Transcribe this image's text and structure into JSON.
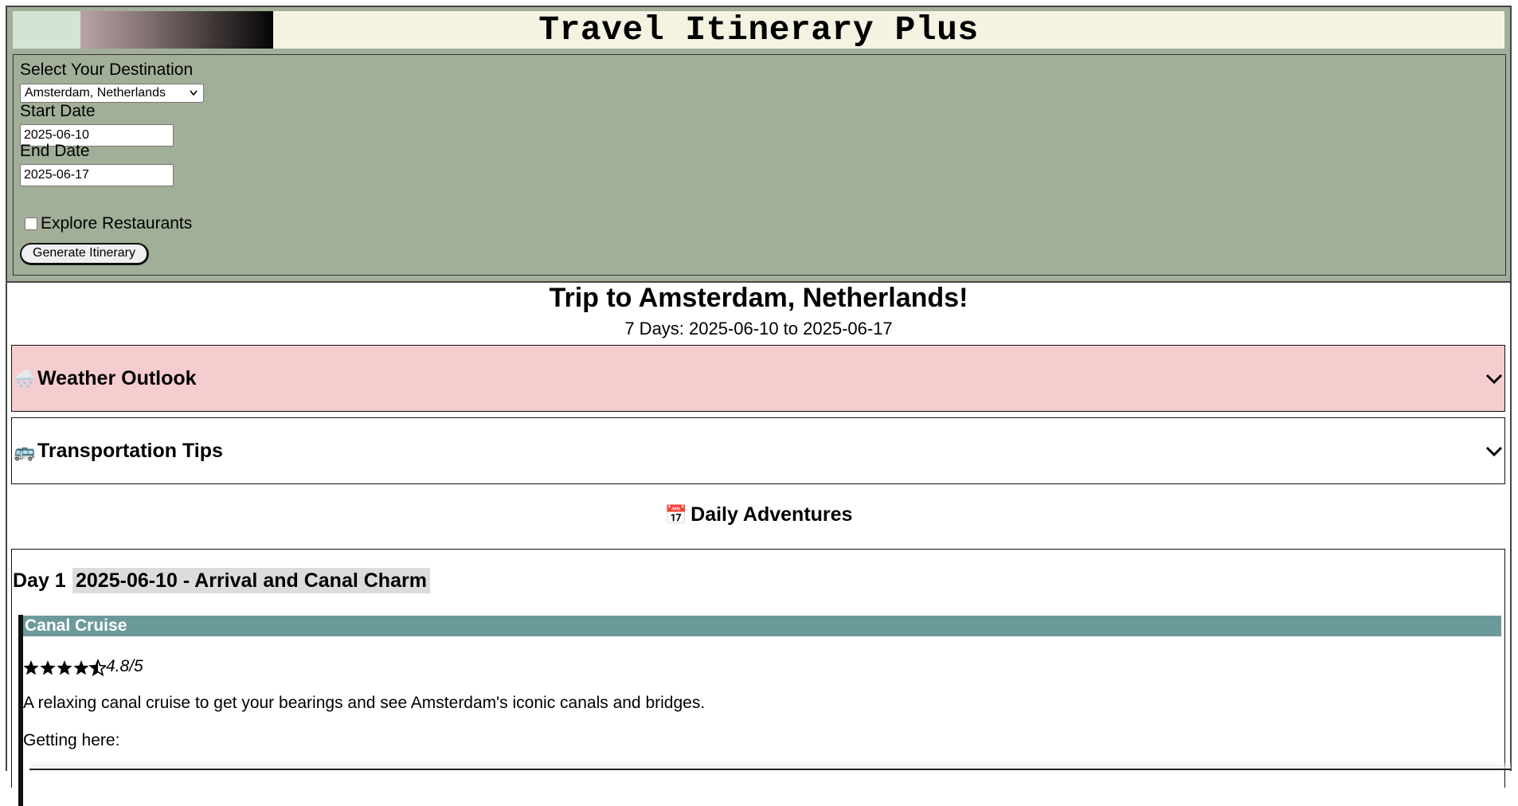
{
  "header": {
    "title": "Travel Itinerary Plus",
    "colors": {
      "band": "#f4f3e1",
      "panel": "#a2af98",
      "mint_swatch": "#d3e4d4"
    }
  },
  "form": {
    "destination_label": "Select Your Destination",
    "destination_value": "Amsterdam, Netherlands",
    "start_label": "Start Date",
    "start_value": "2025-06-10",
    "end_label": "End Date",
    "end_value": "2025-06-17",
    "restaurants_label": "Explore Restaurants",
    "restaurants_checked": false,
    "generate_label": "Generate Itinerary"
  },
  "trip": {
    "title": "Trip to Amsterdam, Netherlands!",
    "subtitle": "7 Days: 2025-06-10 to 2025-06-17"
  },
  "panels": {
    "weather": {
      "icon": "🌨️",
      "icon_name": "snow-cloud-icon",
      "title": "Weather Outlook",
      "color": "#f6cdcf"
    },
    "transport": {
      "icon": "🚌",
      "icon_name": "bus-icon",
      "title": "Transportation Tips"
    }
  },
  "daily": {
    "icon": "📅",
    "heading": "Daily Adventures",
    "days": [
      {
        "label": "Day 1",
        "title": "2025-06-10 - Arrival and Canal Charm",
        "activities": [
          {
            "name": "Canal Cruise",
            "rating": 4.8,
            "rating_text": "4.8/5",
            "description": "A relaxing canal cruise to get your bearings and see Amsterdam's iconic canals and bridges.",
            "getting_here_label": "Getting here:"
          }
        ]
      }
    ]
  }
}
